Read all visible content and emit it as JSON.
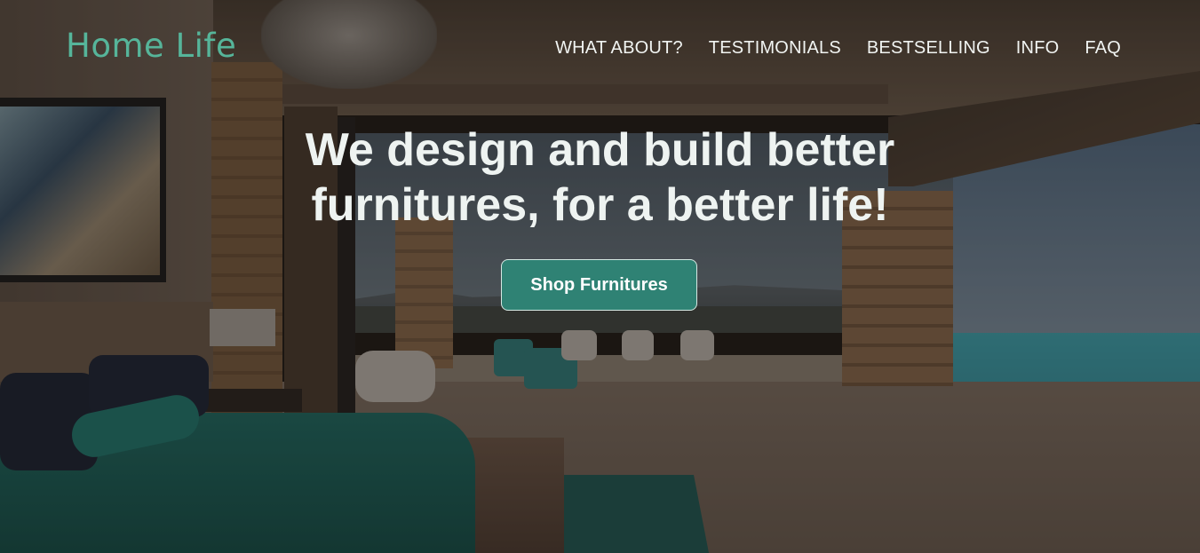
{
  "header": {
    "logo": "Home Life",
    "nav": [
      {
        "label": "WHAT ABOUT?"
      },
      {
        "label": "TESTIMONIALS"
      },
      {
        "label": "BESTSELLING"
      },
      {
        "label": "INFO"
      },
      {
        "label": "FAQ"
      }
    ]
  },
  "hero": {
    "headline_line1": "We design and build better",
    "headline_line2": "furnitures, for a better life!",
    "cta_label": "Shop Furnitures"
  },
  "colors": {
    "brand": "#56b59a",
    "cta_bg": "#2f8274",
    "text_light": "#eef3f1"
  }
}
